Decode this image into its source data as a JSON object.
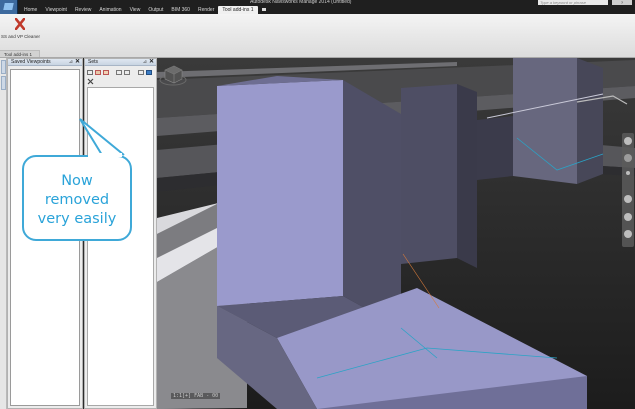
{
  "window": {
    "title": "Autodesk Navisworks Manage 2014   (Untitled)",
    "search_placeholder": "Type a keyword or phrase",
    "help_label": "?"
  },
  "ribbon": {
    "tabs": [
      "Home",
      "Viewpoint",
      "Review",
      "Animation",
      "View",
      "Output",
      "BIM 360",
      "Render",
      "Tool add-ins 1"
    ],
    "active_tab": "Tool add-ins 1",
    "button_label": "SS and VP Cleaner",
    "group_label": "Tool add-ins 1"
  },
  "panels": {
    "saved_viewpoints": {
      "title": "Saved Viewpoints"
    },
    "sets": {
      "title": "Sets"
    },
    "pin_glyph": "⊿",
    "close_glyph": "✕"
  },
  "viewport": {
    "readout": "1:1[+]   FAB - 00"
  },
  "callout": {
    "lines": [
      "Now",
      "removed",
      "very easily"
    ],
    "color": "#2aa3d9"
  },
  "icons": {
    "app": "navisworks-logo-icon",
    "ribbon_button": "red-x-icon",
    "viewcube": "viewcube-icon",
    "nav_tools": [
      "steering-wheel-icon",
      "pan-icon",
      "zoom-icon",
      "orbit-icon",
      "look-icon",
      "select-icon"
    ]
  },
  "colors": {
    "accent": "#3fa9d8",
    "red_x": "#c0392b",
    "active_tab_bg": "#f0f0f0"
  }
}
